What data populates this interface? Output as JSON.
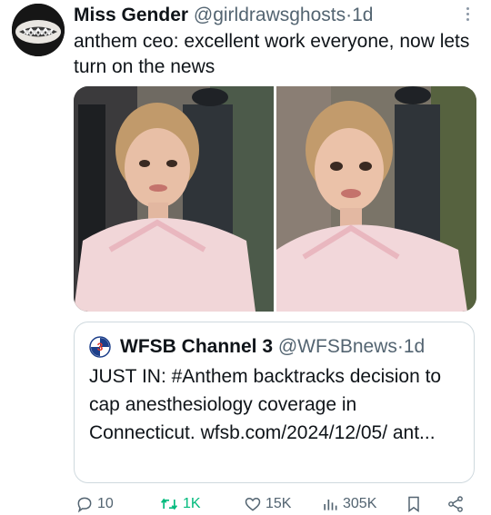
{
  "tweet": {
    "author_name": "Miss Gender",
    "handle": "@girldrawsghosts",
    "separator": "·",
    "time": "1d",
    "text": "anthem ceo: excellent work everyone, now lets turn on the news"
  },
  "quote": {
    "author_name": "WFSB Channel 3",
    "handle": "@WFSBnews",
    "separator": "·",
    "time": "1d",
    "text": "JUST IN: #Anthem backtracks decision to cap anesthesiology coverage in Connecticut. wfsb.com/2024/12/05/ ant..."
  },
  "actions": {
    "replies": "10",
    "retweets": "1K",
    "likes": "15K",
    "views": "305K"
  },
  "colors": {
    "retweet_green": "#00ba7c",
    "muted": "#536471",
    "border": "#cfd9de"
  },
  "icons": [
    "more-icon",
    "reply-icon",
    "retweet-icon",
    "like-icon",
    "views-icon",
    "bookmark-icon",
    "share-icon",
    "wfsb-logo-icon"
  ]
}
